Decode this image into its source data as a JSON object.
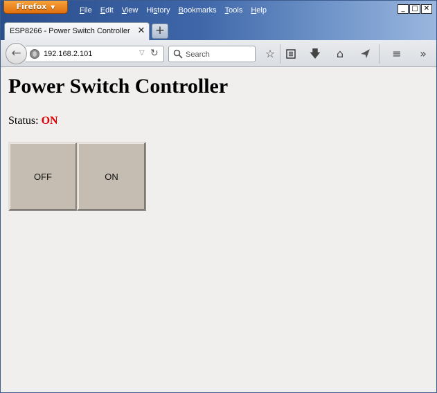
{
  "browser": {
    "app_button": "Firefox",
    "menu": [
      {
        "pre": "",
        "ul": "F",
        "post": "ile"
      },
      {
        "pre": "",
        "ul": "E",
        "post": "dit"
      },
      {
        "pre": "",
        "ul": "V",
        "post": "iew"
      },
      {
        "pre": "Hi",
        "ul": "s",
        "post": "tory"
      },
      {
        "pre": "",
        "ul": "B",
        "post": "ookmarks"
      },
      {
        "pre": "",
        "ul": "T",
        "post": "ools"
      },
      {
        "pre": "",
        "ul": "H",
        "post": "elp"
      }
    ],
    "tab": {
      "title": "ESP8266 - Power Switch Controller"
    },
    "url": "192.168.2.101",
    "search": {
      "placeholder": "Search"
    }
  },
  "page": {
    "title": "Power Switch Controller",
    "status_label": "Status:",
    "status_value": "ON",
    "status_color": "#e00000",
    "buttons": {
      "off": "OFF",
      "on": "ON"
    }
  }
}
